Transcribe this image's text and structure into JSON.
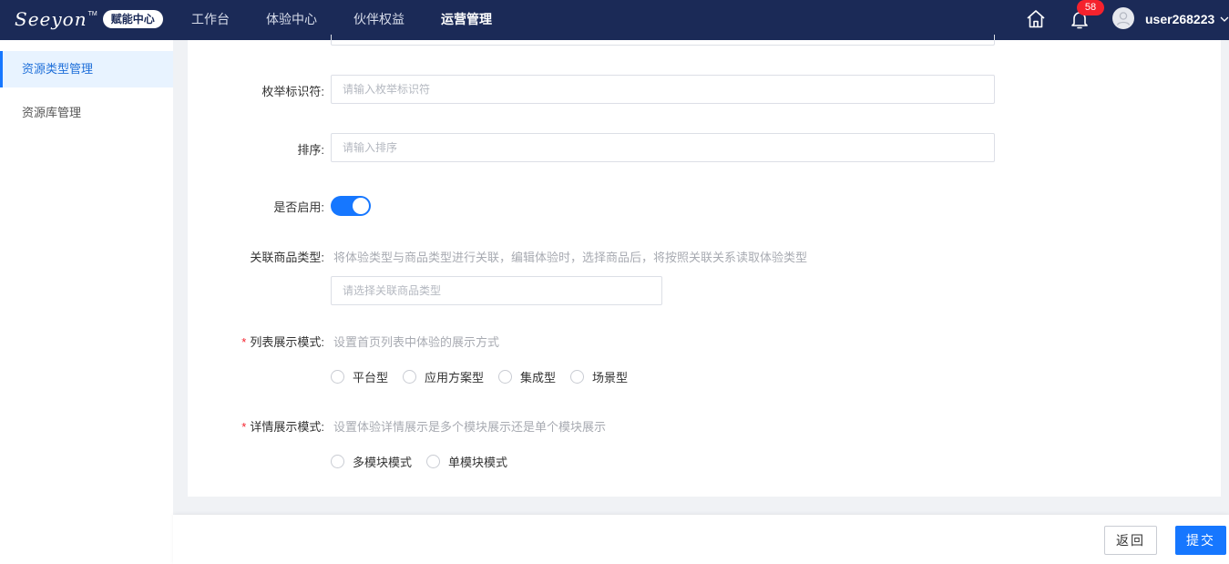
{
  "header": {
    "logo_text": "Seeyon",
    "logo_tm": "TM",
    "logo_badge": "赋能中心",
    "nav": [
      {
        "label": "工作台"
      },
      {
        "label": "体验中心"
      },
      {
        "label": "伙伴权益"
      },
      {
        "label": "运营管理"
      }
    ],
    "notification_count": "58",
    "username": "user268223"
  },
  "sidebar": {
    "items": [
      {
        "label": "资源类型管理"
      },
      {
        "label": "资源库管理"
      }
    ]
  },
  "form": {
    "enum_id": {
      "label": "枚举标识符",
      "placeholder": "请输入枚举标识符"
    },
    "sort": {
      "label": "排序",
      "placeholder": "请输入排序"
    },
    "enabled": {
      "label": "是否启用",
      "value": true
    },
    "product_type": {
      "label": "关联商品类型",
      "hint": "将体验类型与商品类型进行关联，编辑体验时，选择商品后，将按照关联关系读取体验类型",
      "placeholder": "请选择关联商品类型"
    },
    "list_mode": {
      "required_mark": "*",
      "label": "列表展示模式",
      "hint": "设置首页列表中体验的展示方式",
      "options": [
        "平台型",
        "应用方案型",
        "集成型",
        "场景型"
      ]
    },
    "detail_mode": {
      "required_mark": "*",
      "label": "详情展示模式",
      "hint": "设置体验详情展示是多个模块展示还是单个模块展示",
      "options": [
        "多模块模式",
        "单模块模式"
      ]
    },
    "label_suffix": ":"
  },
  "footer": {
    "back_label": "返回",
    "submit_label": "提交"
  },
  "colors": {
    "topbar": "#1b2a57",
    "primary": "#1677ff",
    "required": "#f5222d",
    "badge": "#f5222d"
  }
}
